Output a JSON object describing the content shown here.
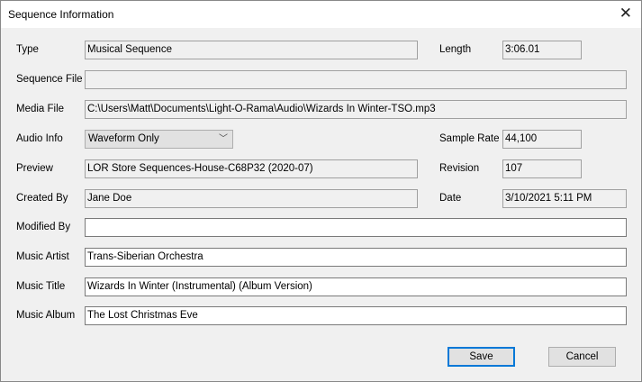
{
  "window": {
    "title": "Sequence Information",
    "close_icon": "close-icon"
  },
  "fields": {
    "type": {
      "label": "Type",
      "value": "Musical Sequence"
    },
    "length": {
      "label": "Length",
      "value": "3:06.01"
    },
    "sequence_file": {
      "label": "Sequence File",
      "value": ""
    },
    "media_file": {
      "label": "Media File",
      "value": "C:\\Users\\Matt\\Documents\\Light-O-Rama\\Audio\\Wizards In Winter-TSO.mp3"
    },
    "audio_info": {
      "label": "Audio Info",
      "value": "Waveform Only"
    },
    "sample_rate": {
      "label": "Sample Rate",
      "value": "44,100"
    },
    "preview": {
      "label": "Preview",
      "value": "LOR Store Sequences-House-C68P32 (2020-07)"
    },
    "revision": {
      "label": "Revision",
      "value": "107"
    },
    "created_by": {
      "label": "Created By",
      "value": "Jane Doe"
    },
    "date": {
      "label": "Date",
      "value": "3/10/2021 5:11 PM"
    },
    "modified_by": {
      "label": "Modified By",
      "value": ""
    },
    "music_artist": {
      "label": "Music Artist",
      "value": "Trans-Siberian Orchestra"
    },
    "music_title": {
      "label": "Music Title",
      "value": "Wizards In Winter (Instrumental) (Album Version)"
    },
    "music_album": {
      "label": "Music Album",
      "value": "The Lost Christmas Eve"
    }
  },
  "buttons": {
    "save": "Save",
    "cancel": "Cancel"
  }
}
